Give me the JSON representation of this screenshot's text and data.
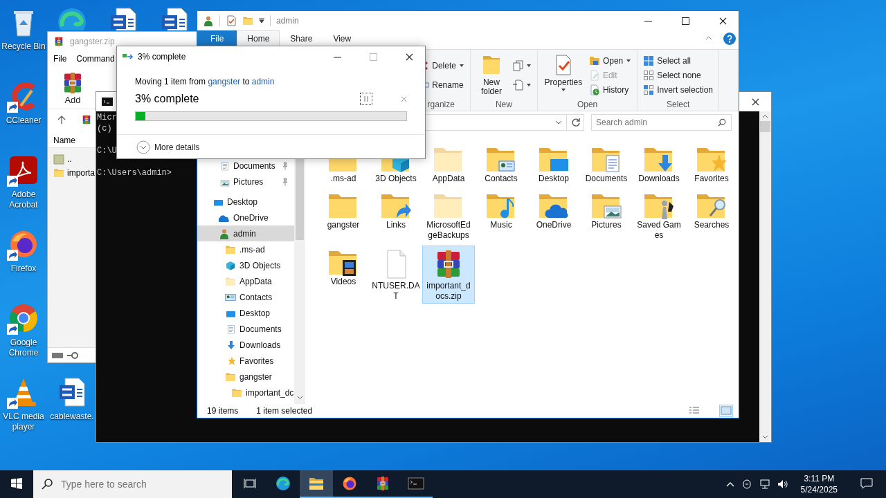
{
  "desktop_icons": [
    {
      "kind": "recycle",
      "label": "Recycle Bin",
      "shortcut": false
    },
    {
      "kind": "edge",
      "shortcut": false
    },
    {
      "kind": "word",
      "shortcut": false
    },
    {
      "kind": "word",
      "shortcut": false
    },
    {
      "kind": "ccleaner",
      "label": "CCleaner",
      "shortcut": true
    },
    {
      "kind": "acrobat",
      "label": "Adobe Acrobat",
      "shortcut": true
    },
    {
      "kind": "firefox",
      "label": "Firefox",
      "shortcut": true
    },
    {
      "kind": "chrome",
      "label": "Google Chrome",
      "shortcut": true
    },
    {
      "kind": "vlc",
      "label": "VLC media player",
      "shortcut": true
    },
    {
      "kind": "word",
      "label": "cablewaste.",
      "shortcut": false
    }
  ],
  "winrar_window": {
    "title": "gangster.zip",
    "menu": [
      "File",
      "Command"
    ],
    "toolbar": [
      "Add"
    ],
    "columns": [
      "Name"
    ],
    "rows": [
      {
        "kind": "up",
        "name": ".."
      },
      {
        "kind": "folder",
        "name": "importa"
      }
    ]
  },
  "cmd_window": {
    "blocks": [
      [
        "Micr",
        "(c)"
      ],
      [
        "C:\\U"
      ],
      [
        "C:\\Users\\admin>"
      ]
    ]
  },
  "explorer": {
    "title": "admin",
    "tabs": [
      {
        "label": "File",
        "kind": "file",
        "selected": false
      },
      {
        "label": "Home",
        "kind": "tab",
        "selected": true
      },
      {
        "label": "Share",
        "kind": "tab",
        "selected": false
      },
      {
        "label": "View",
        "kind": "tab",
        "selected": false
      }
    ],
    "ribbon": [
      {
        "label": "rganize",
        "buttons": [
          {
            "kind": "delete",
            "label": "Delete",
            "dropdown": true,
            "disabled": false
          },
          {
            "kind": "rename",
            "label": "Rename",
            "dropdown": false,
            "disabled": false
          }
        ]
      },
      {
        "label": "New",
        "buttons": [
          {
            "kind": "new-folder",
            "label": "New folder",
            "dropdown": false,
            "disabled": false
          },
          {
            "kind": "new-item",
            "dropdown": true,
            "disabled": false
          },
          {
            "kind": "easy-access",
            "dropdown": true,
            "disabled": false
          }
        ]
      },
      {
        "label": "Open",
        "buttons": [
          {
            "kind": "properties",
            "label": "Properties",
            "dropdown": true,
            "disabled": false
          },
          {
            "kind": "open",
            "label": "Open",
            "dropdown": true,
            "disabled": false
          },
          {
            "kind": "edit",
            "label": "Edit",
            "dropdown": false,
            "disabled": true
          },
          {
            "kind": "history",
            "label": "History",
            "dropdown": false,
            "disabled": false
          }
        ]
      },
      {
        "label": "Select",
        "buttons": [
          {
            "kind": "select-all",
            "label": "Select all",
            "dropdown": false,
            "disabled": false
          },
          {
            "kind": "select-none",
            "label": "Select none",
            "dropdown": false,
            "disabled": false
          },
          {
            "kind": "invert",
            "label": "Invert selection",
            "dropdown": false,
            "disabled": false
          }
        ]
      }
    ],
    "search_placeholder": "Search admin",
    "quick_access": [
      {
        "kind": "documents",
        "label": "Documents",
        "pinned": true,
        "selected": false,
        "hidden": false
      },
      {
        "kind": "pictures",
        "label": "Pictures",
        "pinned": true,
        "selected": false,
        "hidden": false
      }
    ],
    "tree": [
      {
        "kind": "desktop",
        "label": "Desktop",
        "selected": false,
        "hidden": false,
        "children": [
          {
            "kind": "onedrive",
            "label": "OneDrive",
            "selected": false,
            "hidden": false
          },
          {
            "kind": "user",
            "label": "admin",
            "selected": true,
            "hidden": false,
            "children": [
              {
                "kind": "plain",
                "label": ".ms-ad",
                "selected": false,
                "hidden": false
              },
              {
                "kind": "objects",
                "label": "3D Objects",
                "selected": false,
                "hidden": false
              },
              {
                "kind": "plain",
                "label": "AppData",
                "selected": false,
                "hidden": true
              },
              {
                "kind": "contacts",
                "label": "Contacts",
                "selected": false,
                "hidden": false
              },
              {
                "kind": "desktop",
                "label": "Desktop",
                "selected": false,
                "hidden": false
              },
              {
                "kind": "documents",
                "label": "Documents",
                "selected": false,
                "hidden": false
              },
              {
                "kind": "downloads",
                "label": "Downloads",
                "selected": false,
                "hidden": false
              },
              {
                "kind": "favorites",
                "label": "Favorites",
                "selected": false,
                "hidden": false
              },
              {
                "kind": "plain",
                "label": "gangster",
                "selected": false,
                "hidden": false,
                "children": [
                  {
                    "kind": "plain",
                    "label": "important_dc",
                    "selected": false,
                    "hidden": false
                  }
                ]
              }
            ]
          }
        ]
      }
    ],
    "files": [
      {
        "kind": "plain",
        "name": ".ms-ad",
        "selected": false,
        "hidden": false
      },
      {
        "kind": "objects",
        "name": "3D Objects",
        "selected": false,
        "hidden": false
      },
      {
        "kind": "plain",
        "name": "AppData",
        "selected": false,
        "hidden": true
      },
      {
        "kind": "contacts",
        "name": "Contacts",
        "selected": false,
        "hidden": false
      },
      {
        "kind": "desktop",
        "name": "Desktop",
        "selected": false,
        "hidden": false
      },
      {
        "kind": "documents",
        "name": "Documents",
        "selected": false,
        "hidden": false
      },
      {
        "kind": "downloads",
        "name": "Downloads",
        "selected": false,
        "hidden": false
      },
      {
        "kind": "favorites",
        "name": "Favorites",
        "selected": false,
        "hidden": false
      },
      {
        "kind": "plain",
        "name": "gangster",
        "selected": false,
        "hidden": false
      },
      {
        "kind": "links",
        "name": "Links",
        "selected": false,
        "hidden": false
      },
      {
        "kind": "plain",
        "name": "MicrosoftEdgeBackups",
        "selected": false,
        "hidden": true
      },
      {
        "kind": "music",
        "name": "Music",
        "selected": false,
        "hidden": false
      },
      {
        "kind": "onedrive",
        "name": "OneDrive",
        "selected": false,
        "hidden": false
      },
      {
        "kind": "pictures",
        "name": "Pictures",
        "selected": false,
        "hidden": false
      },
      {
        "kind": "games",
        "name": "Saved Games",
        "selected": false,
        "hidden": false
      },
      {
        "kind": "searches",
        "name": "Searches",
        "selected": false,
        "hidden": false
      },
      {
        "kind": "videos",
        "name": "Videos",
        "selected": false,
        "hidden": false
      },
      {
        "kind": "file",
        "name": "NTUSER.DAT",
        "selected": false,
        "hidden": false
      },
      {
        "kind": "archive",
        "name": "important_docs.zip",
        "selected": true,
        "hidden": false
      }
    ],
    "status": {
      "count": "19 items",
      "selection": "1 item selected",
      "views": [
        {
          "kind": "details",
          "selected": false
        },
        {
          "kind": "large-icons",
          "selected": true
        }
      ]
    }
  },
  "dialog": {
    "title": "3% complete",
    "from_text": "Moving 1 item from",
    "source": "gangster",
    "to_text": "to",
    "destination": "admin",
    "progress_text": "3% complete",
    "level": 0.035,
    "details": "More details"
  },
  "taskbar": {
    "search_placeholder": "Type here to search",
    "apps": [
      {
        "kind": "edge",
        "running": false,
        "active": false
      },
      {
        "kind": "explorer",
        "running": true,
        "active": true
      },
      {
        "kind": "firefox",
        "running": true,
        "active": false
      },
      {
        "kind": "winrar",
        "running": true,
        "active": false
      },
      {
        "kind": "cmd",
        "running": true,
        "active": false
      }
    ],
    "time": "3:11 PM",
    "date": "5/24/2025"
  }
}
